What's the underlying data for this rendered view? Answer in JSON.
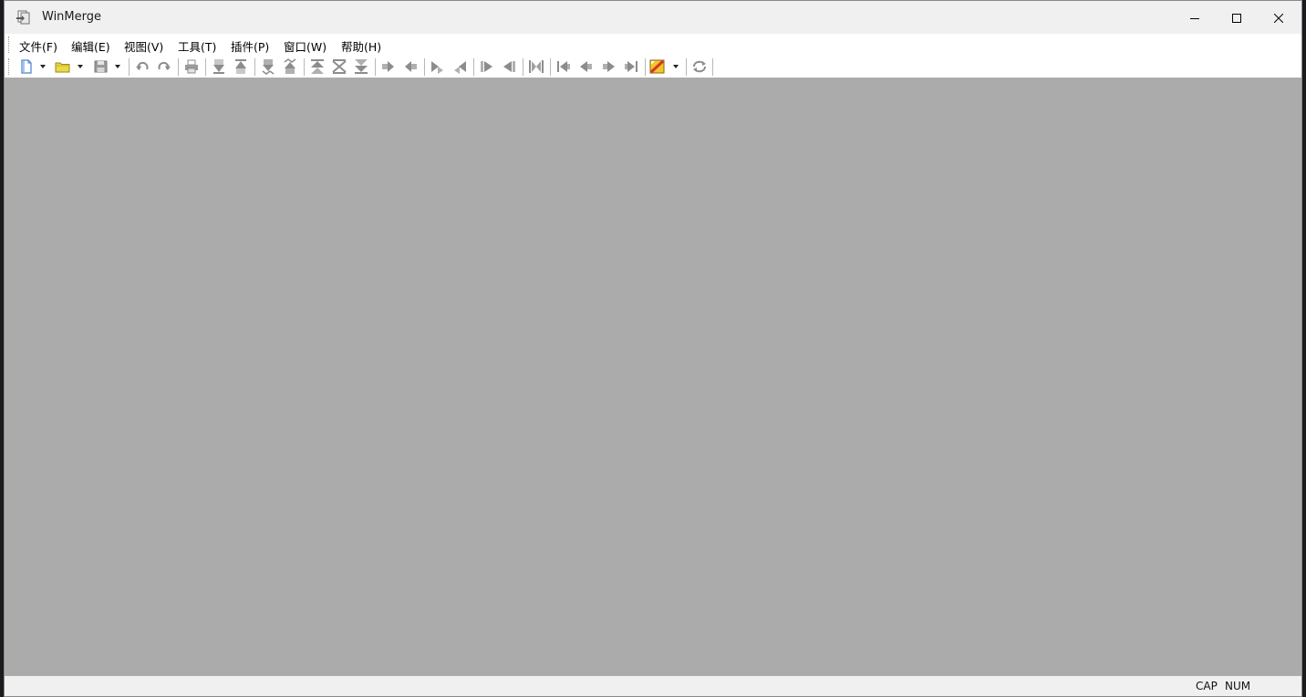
{
  "window": {
    "title": "WinMerge"
  },
  "caption_buttons": [
    {
      "name": "minimize-button",
      "icon": "minimize-icon"
    },
    {
      "name": "maximize-button",
      "icon": "maximize-icon"
    },
    {
      "name": "close-button",
      "icon": "close-icon"
    }
  ],
  "menu": {
    "items": [
      {
        "label": "文件(F)"
      },
      {
        "label": "编辑(E)"
      },
      {
        "label": "视图(V)"
      },
      {
        "label": "工具(T)"
      },
      {
        "label": "插件(P)"
      },
      {
        "label": "窗口(W)"
      },
      {
        "label": "帮助(H)"
      }
    ]
  },
  "toolbar": {
    "buttons": [
      {
        "icon": "new-icon"
      },
      {
        "icon": "open-icon"
      },
      {
        "icon": "save-icon"
      },
      {
        "icon": "undo-icon"
      },
      {
        "icon": "redo-icon"
      },
      {
        "icon": "print-icon"
      },
      {
        "icon": "next-diff-icon"
      },
      {
        "icon": "prev-diff-icon"
      },
      {
        "icon": "next-conflict-icon"
      },
      {
        "icon": "prev-conflict-icon"
      },
      {
        "icon": "first-diff-icon"
      },
      {
        "icon": "current-diff-icon"
      },
      {
        "icon": "last-diff-icon"
      },
      {
        "icon": "copy-right-icon"
      },
      {
        "icon": "copy-left-icon"
      },
      {
        "icon": "copy-right-advance-icon"
      },
      {
        "icon": "copy-left-advance-icon"
      },
      {
        "icon": "all-right-icon"
      },
      {
        "icon": "all-left-icon"
      },
      {
        "icon": "compare-icon"
      },
      {
        "icon": "first-file-icon"
      },
      {
        "icon": "prev-file-icon"
      },
      {
        "icon": "next-file-icon"
      },
      {
        "icon": "last-file-icon"
      },
      {
        "icon": "options-icon"
      },
      {
        "icon": "refresh-icon"
      }
    ],
    "colors": {
      "icon_gray": "#8c8c8c",
      "open_yellow": "#e8d84a",
      "new_blue": "#4a7fd0",
      "options_red": "#d2362a"
    }
  },
  "client_area": {
    "background": "#ababab"
  },
  "statusbar": {
    "indicators": [
      "CAP",
      "NUM"
    ]
  }
}
